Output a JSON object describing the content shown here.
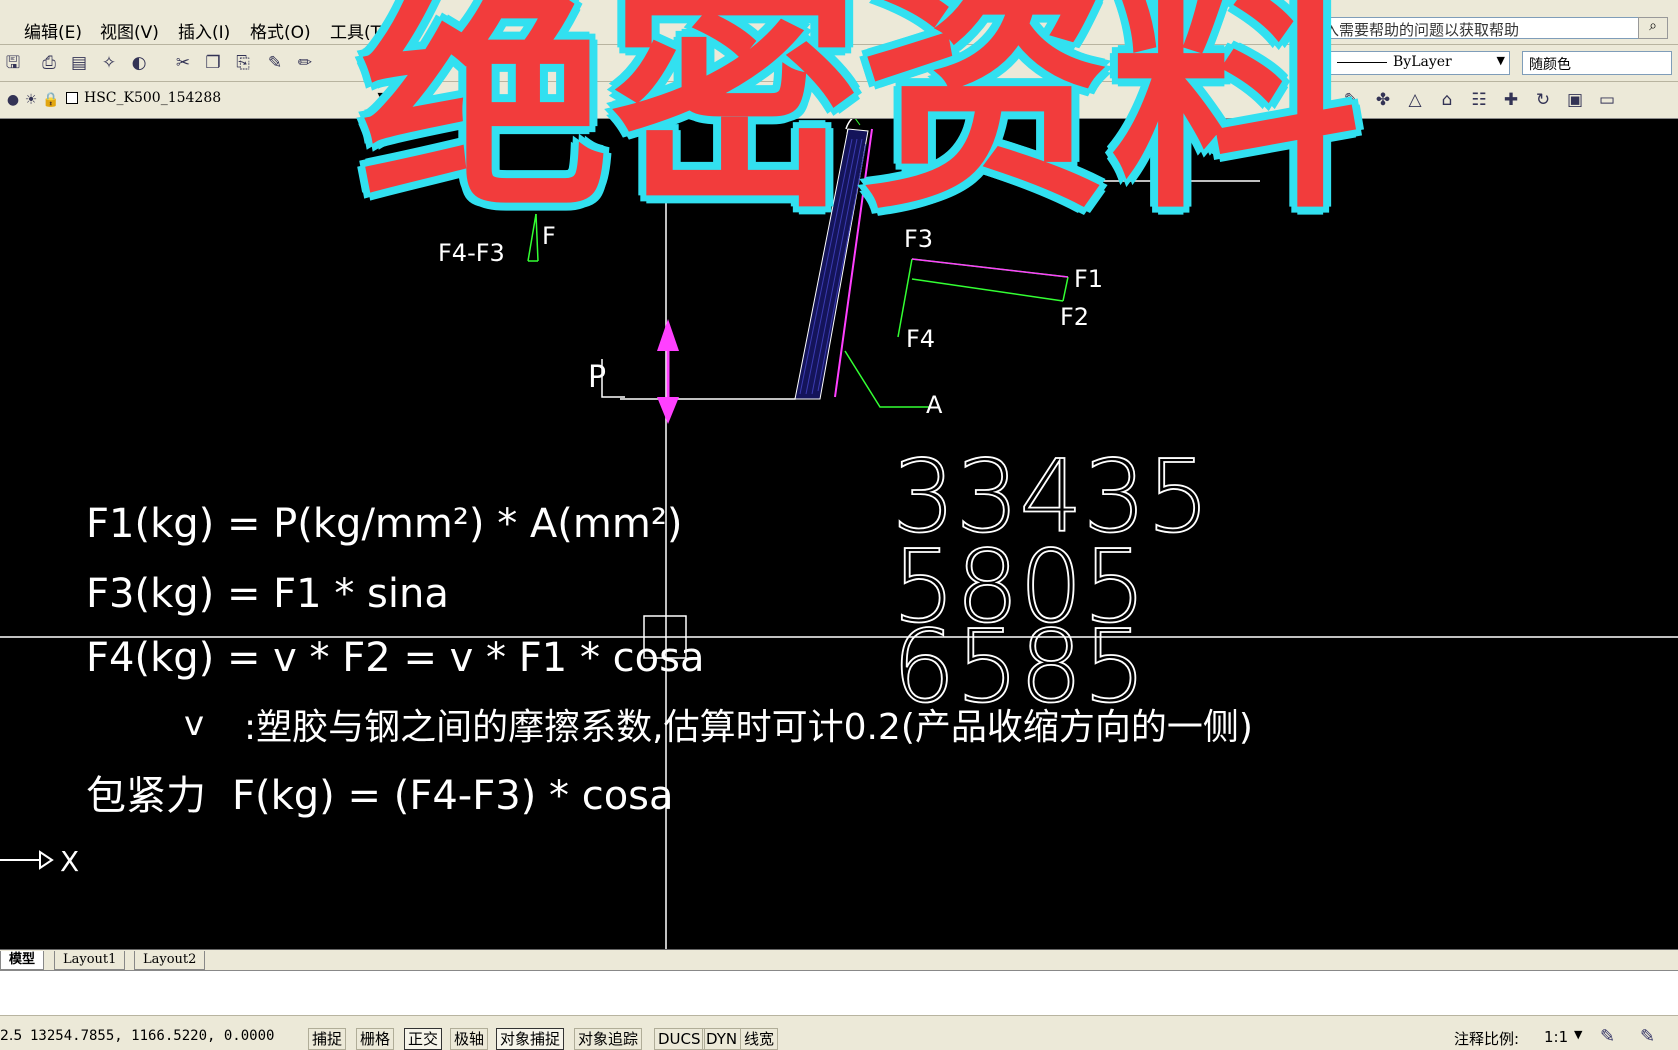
{
  "menubar": {
    "items": [
      "编辑(E)",
      "视图(V)",
      "插入(I)",
      "格式(O)",
      "工具(T)"
    ],
    "help_placeholder": "键入需要帮助的问题以获取帮助"
  },
  "toolbar2": {
    "layer_name": "HSC_K500_154288"
  },
  "properties": {
    "linetype": "ByLayer",
    "color": "随颜色"
  },
  "drawing": {
    "labels": {
      "F4_F3": "F4-F3",
      "F": "F",
      "F3": "F3",
      "F1": "F1",
      "F2": "F2",
      "F4": "F4",
      "P": "P",
      "A": "A",
      "X": "X"
    },
    "numbers": [
      "33435",
      "5805",
      "6585"
    ],
    "formulas": {
      "f1": "F1(kg) = P(kg/mm²) * A(mm²)",
      "f3": "F3(kg) = F1 * sina",
      "f4": "F4(kg) = v * F2 = v * F1 * cosa",
      "v_symbol": "v",
      "v_note": ":塑胶与钢之间的摩擦系数,估算时可计0.2(产品收缩方向的一侧)",
      "grip_prefix": "包紧力",
      "grip": "F(kg) = (F4-F3) * cosa"
    }
  },
  "tabs": [
    "模型",
    "Layout1",
    "Layout2"
  ],
  "status": {
    "coords": "13254.7855, 1166.5220, 0.0000",
    "left_value": "2.5",
    "buttons": [
      "捕捉",
      "栅格",
      "正交",
      "极轴",
      "对象捕捉",
      "对象追踪",
      "DUCS",
      "DYN",
      "线宽"
    ],
    "annotation_scale_label": "注释比例:",
    "annotation_scale": "1:1"
  },
  "overlay": {
    "stamp": "绝密资料"
  },
  "colors": {
    "stamp_fill": "#f23c3c",
    "stamp_outline": "#32e0f0",
    "canvas": "#000000",
    "force_lines": "#33ff33",
    "magenta": "#ff40ff"
  }
}
